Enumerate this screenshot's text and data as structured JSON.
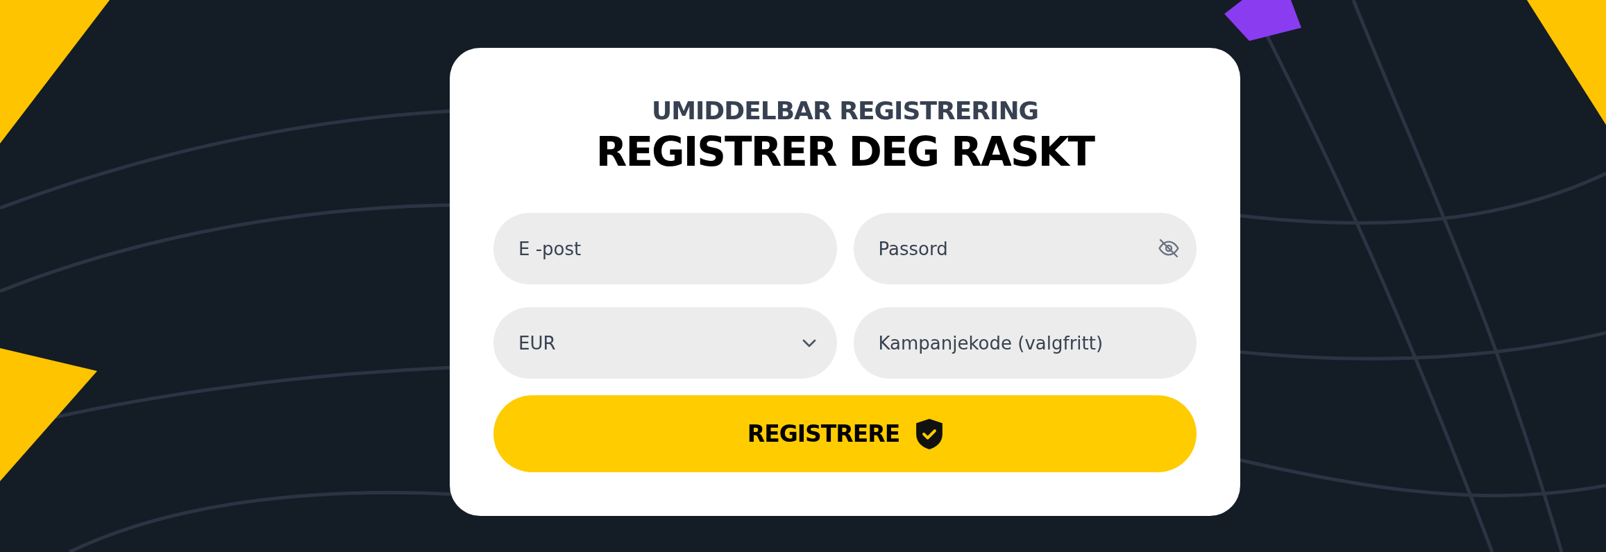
{
  "header": {
    "subtitle": "UMIDDELBAR REGISTRERING",
    "title": "REGISTRER DEG RASKT"
  },
  "fields": [
    {
      "kind": "text",
      "placeholder": "E -post"
    },
    {
      "kind": "password",
      "placeholder": "Passord"
    },
    {
      "kind": "select",
      "value": "EUR"
    },
    {
      "kind": "text",
      "placeholder": "Kampanjekode (valgfritt)"
    }
  ],
  "submit": {
    "label": "REGISTRERE"
  }
}
